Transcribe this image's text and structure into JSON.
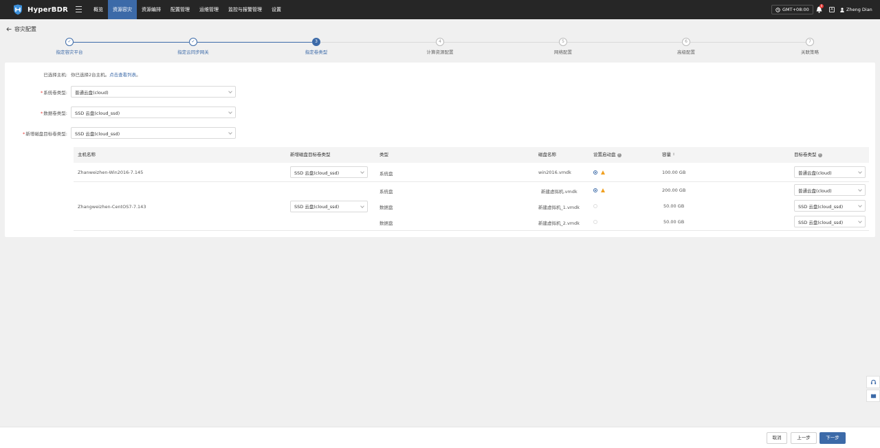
{
  "brand": {
    "name": "HyperBDR"
  },
  "nav": {
    "items": [
      {
        "label": "概览",
        "active": false
      },
      {
        "label": "资源容灾",
        "active": true
      },
      {
        "label": "资源编排",
        "active": false
      },
      {
        "label": "配置管理",
        "active": false
      },
      {
        "label": "运维管理",
        "active": false
      },
      {
        "label": "监控与报警管理",
        "active": false
      },
      {
        "label": "设置",
        "active": false
      }
    ]
  },
  "header_right": {
    "timezone": "GMT+08:00",
    "notification_count": "0",
    "user_name": "Zheng Dian"
  },
  "page": {
    "title": "容灾配置"
  },
  "steps": [
    {
      "index": "✓",
      "label": "指定容灾平台",
      "state": "done"
    },
    {
      "index": "✓",
      "label": "指定云同步网关",
      "state": "done"
    },
    {
      "index": "3",
      "label": "指定卷类型",
      "state": "current"
    },
    {
      "index": "4",
      "label": "计算资源配置",
      "state": "todo"
    },
    {
      "index": "5",
      "label": "网络配置",
      "state": "todo"
    },
    {
      "index": "6",
      "label": "高级配置",
      "state": "todo"
    },
    {
      "index": "7",
      "label": "关联策略",
      "state": "todo"
    }
  ],
  "form": {
    "selected_hosts_label": "已选择主机:",
    "selected_hosts_text": "你已选择2台主机。",
    "selected_hosts_link": "点击查看列表",
    "selected_hosts_end": "。",
    "system_volume_label": "系统卷类型:",
    "system_volume_value": "普通云盘(cloud)",
    "data_volume_label": "数据卷类型:",
    "data_volume_value": "SSD 云盘(cloud_ssd)",
    "new_disk_label": "新增磁盘目标卷类型:",
    "new_disk_value": "SSD 云盘(cloud_ssd)"
  },
  "table": {
    "headers": {
      "host": "主机名称",
      "new_disk_type": "新增磁盘目标卷类型",
      "type": "类型",
      "disk_name": "磁盘名称",
      "boot_disk": "设置启动盘",
      "capacity": "容量",
      "target_type": "目标卷类型"
    },
    "hosts": [
      {
        "name": "Zhanweizhen-Win2016-7.145",
        "new_disk_type": "SSD 云盘(cloud_ssd)",
        "disks": [
          {
            "type": "系统盘",
            "name": "win2016.vmdk",
            "boot": true,
            "warn": true,
            "capacity": "100.00 GB",
            "target": "普通云盘(cloud)"
          }
        ]
      },
      {
        "name": "Zhangweizhen-CentOS7-7.143",
        "new_disk_type": "SSD 云盘(cloud_ssd)",
        "disks": [
          {
            "type": "系统盘",
            "name": "新建虚拟机.vmdk",
            "boot": true,
            "warn": true,
            "capacity": "200.00 GB",
            "target": "普通云盘(cloud)"
          },
          {
            "type": "数据盘",
            "name": "新建虚拟机_1.vmdk",
            "boot": false,
            "warn": false,
            "capacity": "50.00 GB",
            "target": "SSD 云盘(cloud_ssd)"
          },
          {
            "type": "数据盘",
            "name": "新建虚拟机_2.vmdk",
            "boot": false,
            "warn": false,
            "capacity": "50.00 GB",
            "target": "SSD 云盘(cloud_ssd)"
          }
        ]
      }
    ]
  },
  "footer": {
    "cancel": "取消",
    "prev": "上一步",
    "next": "下一步"
  },
  "colors": {
    "accent": "#3c6aa8",
    "topbar": "#262626",
    "warning": "#f0a020",
    "required": "#e53935"
  }
}
